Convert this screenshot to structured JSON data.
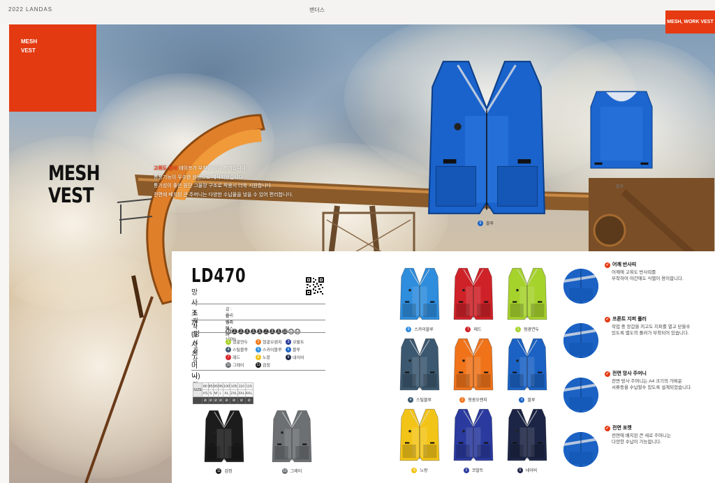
{
  "header": {
    "left": "2022 LANDAS",
    "center": "랜더스",
    "right_tag": "MESH, WORK VEST"
  },
  "section_tag": "MESH\nVEST",
  "title": "MESH\nVEST",
  "intro": {
    "line1_highlight": "고휘도 반사 ",
    "line1_rest": "테이프가 부착된 망사 조끼입니다.",
    "line2": "통풍기능이 우수한 원단으로 제작되었습니다.",
    "line3": "통기성이 좋은 원단 그물망 구조로 착용시 더욱 시원합니다.",
    "line4": "전면에 배치된 큰 주머니는 다양한 수납물을 넣을 수 있어 편리합니다."
  },
  "hero": {
    "main_label_num": "6",
    "main_label": "블루",
    "side_label": "블루"
  },
  "product": {
    "model": "LD470",
    "name": "망사 조끼 (망사 주머니)",
    "specs": {
      "material_label": "소재",
      "material_lines": [
        "겉 : 폴리에스터 100%",
        "안 : 폴리에스터 100%"
      ],
      "season_label": "착용시기",
      "months": [
        "1",
        "2",
        "3",
        "4",
        "5",
        "6",
        "7",
        "8",
        "9",
        "10",
        "11",
        "12"
      ],
      "color_label": "색상",
      "colors": [
        {
          "n": "1",
          "name": "형광연두",
          "c": "#a8d32a"
        },
        {
          "n": "2",
          "name": "형광오렌지",
          "c": "#f07a1a"
        },
        {
          "n": "3",
          "name": "코발트",
          "c": "#2c3d9c"
        },
        {
          "n": "4",
          "name": "스틸블루",
          "c": "#3f5a73"
        },
        {
          "n": "5",
          "name": "스카이블루",
          "c": "#2e8fe0"
        },
        {
          "n": "6",
          "name": "블루",
          "c": "#1b64c6"
        },
        {
          "n": "7",
          "name": "레드",
          "c": "#d6252a"
        },
        {
          "n": "8",
          "name": "노랑",
          "c": "#f2c21a"
        },
        {
          "n": "9",
          "name": "네이비",
          "c": "#1d2848"
        },
        {
          "n": "10",
          "name": "그레이",
          "c": "#6a6e70"
        },
        {
          "n": "11",
          "name": "검정",
          "c": "#1a1a1a"
        }
      ],
      "size_label": "사이즈",
      "size_row_title": "SIZE",
      "size_nums": [
        "80",
        "85",
        "90",
        "95",
        "100",
        "105",
        "110",
        "115"
      ],
      "size_codes": [
        "XS",
        "S",
        "M",
        "L",
        "XL",
        "2XL",
        "3XL",
        "4XL"
      ]
    }
  },
  "bottom_vests": [
    {
      "n": "11",
      "name": "검정",
      "c": "#1c1c1c"
    },
    {
      "n": "10",
      "name": "그레이",
      "c": "#6c7072"
    }
  ],
  "grid_vests": [
    {
      "n": "5",
      "name": "스카이블루",
      "c": "#2e8ddd"
    },
    {
      "n": "7",
      "name": "레드",
      "c": "#cf2228"
    },
    {
      "n": "1",
      "name": "형광연두",
      "c": "#a6d22c"
    },
    {
      "n": "4",
      "name": "스틸블루",
      "c": "#3c5870"
    },
    {
      "n": "2",
      "name": "형광오렌지",
      "c": "#f0731a"
    },
    {
      "n": "6",
      "name": "블루",
      "c": "#1b62c4"
    },
    {
      "n": "8",
      "name": "노랑",
      "c": "#f3c418"
    },
    {
      "n": "3",
      "name": "코발트",
      "c": "#2a3a9e"
    },
    {
      "n": "9",
      "name": "네이비",
      "c": "#1c2545"
    }
  ],
  "features": [
    {
      "title": "어깨 반사띠",
      "desc": "어깨에 고휘도 반사띠를\n부착하여 야간에도 식별이 용이합니다."
    },
    {
      "title": "프론트 지퍼 풀러",
      "desc": "작업 중 장갑을 끼고도 지퍼를 열고 닫을수\n있도록 별도의 풀러가 부착되어 있습니다."
    },
    {
      "title": "전면 망사 주머니",
      "desc": "전면 망사 주머니는 A4 크기의 가벼운\n서류등을 수납할수 있도록 설계되었습니다."
    },
    {
      "title": "전면 포켓",
      "desc": "전면에 배치된 큰 새로 주머니는\n다양한 수납이 가능합니다."
    }
  ]
}
